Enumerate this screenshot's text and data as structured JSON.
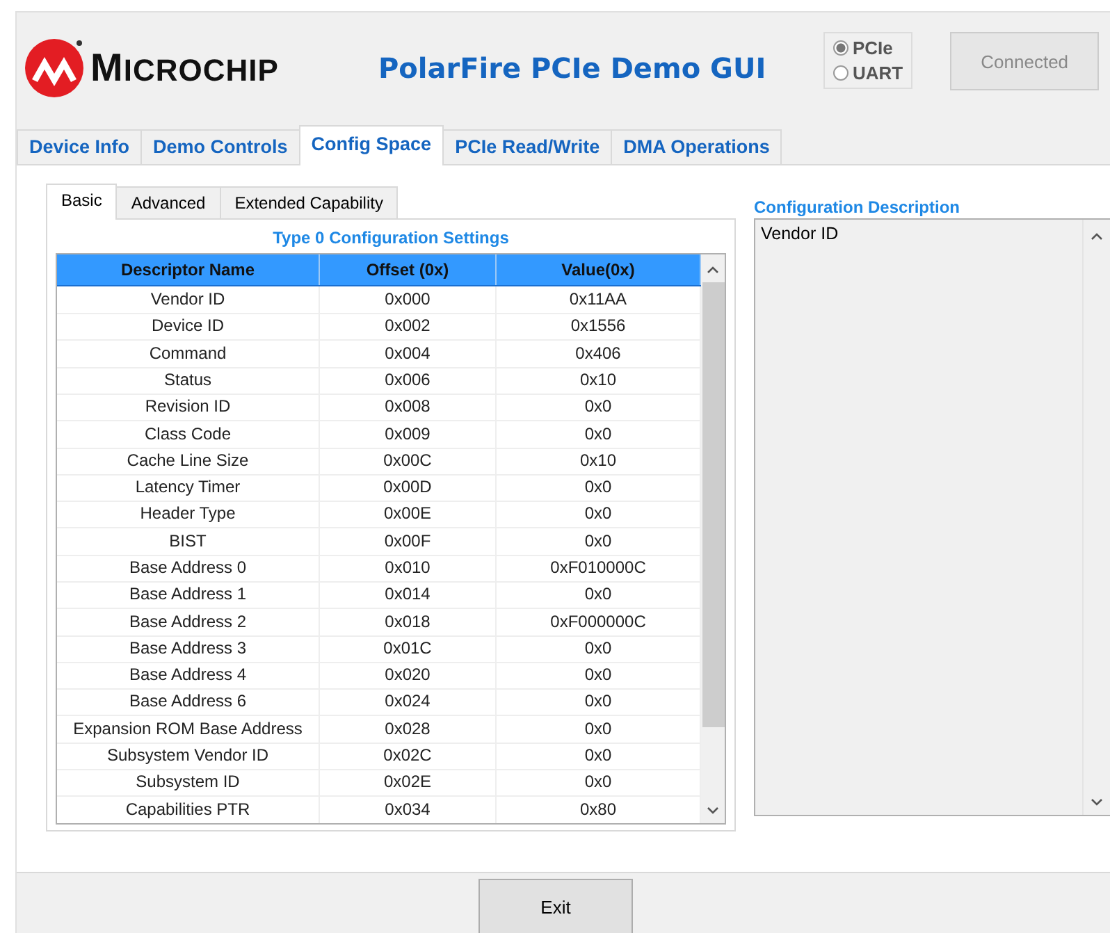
{
  "header": {
    "logo_text": "MICROCHIP",
    "app_title": "PolarFire PCIe Demo GUI",
    "interface_options": [
      {
        "label": "PCIe",
        "selected": true
      },
      {
        "label": "UART",
        "selected": false
      }
    ],
    "connect_button": {
      "label": "Connected",
      "disabled": true
    }
  },
  "tabs": [
    {
      "label": "Device Info",
      "selected": false
    },
    {
      "label": "Demo Controls",
      "selected": false
    },
    {
      "label": "Config Space",
      "selected": true
    },
    {
      "label": "PCIe Read/Write",
      "selected": false
    },
    {
      "label": "DMA Operations",
      "selected": false
    }
  ],
  "sub_tabs": [
    {
      "label": "Basic",
      "selected": true
    },
    {
      "label": "Advanced",
      "selected": false
    },
    {
      "label": "Extended Capability",
      "selected": false
    }
  ],
  "table": {
    "title": "Type 0 Configuration Settings",
    "columns": [
      "Descriptor Name",
      "Offset (0x)",
      "Value(0x)"
    ],
    "rows": [
      [
        "Vendor ID",
        "0x000",
        "0x11AA"
      ],
      [
        "Device ID",
        "0x002",
        "0x1556"
      ],
      [
        "Command",
        "0x004",
        "0x406"
      ],
      [
        "Status",
        "0x006",
        "0x10"
      ],
      [
        "Revision ID",
        "0x008",
        "0x0"
      ],
      [
        "Class Code",
        "0x009",
        "0x0"
      ],
      [
        "Cache Line Size",
        "0x00C",
        "0x10"
      ],
      [
        "Latency Timer",
        "0x00D",
        "0x0"
      ],
      [
        "Header Type",
        "0x00E",
        "0x0"
      ],
      [
        "BIST",
        "0x00F",
        "0x0"
      ],
      [
        "Base Address 0",
        "0x010",
        "0xF010000C"
      ],
      [
        "Base Address 1",
        "0x014",
        "0x0"
      ],
      [
        "Base Address 2",
        "0x018",
        "0xF000000C"
      ],
      [
        "Base Address 3",
        "0x01C",
        "0x0"
      ],
      [
        "Base Address 4",
        "0x020",
        "0x0"
      ],
      [
        "Base Address 6",
        "0x024",
        "0x0"
      ],
      [
        "Expansion ROM Base Address",
        "0x028",
        "0x0"
      ],
      [
        "Subsystem Vendor ID",
        "0x02C",
        "0x0"
      ],
      [
        "Subsystem ID",
        "0x02E",
        "0x0"
      ],
      [
        "Capabilities PTR",
        "0x034",
        "0x80"
      ]
    ]
  },
  "description": {
    "label": "Configuration Description",
    "text": "Vendor ID"
  },
  "exit_button": "Exit"
}
